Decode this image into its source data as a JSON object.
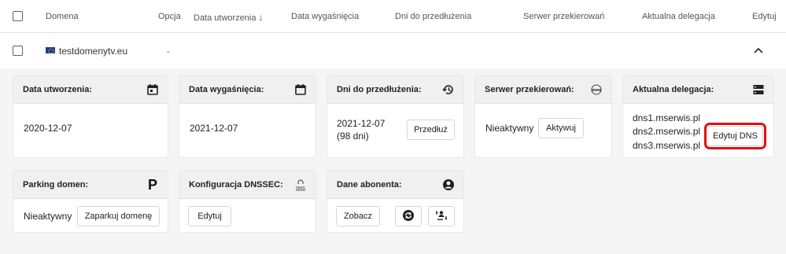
{
  "header": {
    "domain": "Domena",
    "option": "Opcja",
    "created": "Data utworzenia",
    "sort_arrow": "↓",
    "expires": "Data wygaśnięcia",
    "days": "Dni do przedłużenia",
    "redirect": "Serwer przekierowań",
    "delegation": "Aktualna delegacja",
    "edit": "Edytuj"
  },
  "row": {
    "domain": "testdomenytv.eu",
    "option": "-",
    "chevron": "⌃"
  },
  "cards": {
    "created": {
      "title": "Data utworzenia:",
      "value": "2020-12-07"
    },
    "expires": {
      "title": "Data wygaśnięcia:",
      "value": "2021-12-07"
    },
    "days": {
      "title": "Dni do przedłużenia:",
      "value": "2021-12-07",
      "sub": "(98 dni)",
      "button": "Przedłuż"
    },
    "redirect": {
      "title": "Serwer przekierowań:",
      "value": "Nieaktywny",
      "button": "Aktywuj",
      "icon_text": "www"
    },
    "delegation": {
      "title": "Aktualna delegacja:",
      "ns": [
        "dns1.mserwis.pl",
        "dns2.mserwis.pl",
        "dns3.mserwis.pl"
      ],
      "button": "Edytuj DNS"
    },
    "parking": {
      "title": "Parking domen:",
      "value": "Nieaktywny",
      "button": "Zaparkuj domenę",
      "icon_text": "P"
    },
    "dnssec": {
      "title": "Konfiguracja DNSSEC:",
      "button": "Edytuj",
      "icon_text": "DNS"
    },
    "subscriber": {
      "title": "Dane abonenta:",
      "button": "Zobacz"
    }
  },
  "colors": {
    "highlight": "#e01010",
    "card_header_bg": "#f0f0f0",
    "panel_bg": "#f5f5f5"
  }
}
